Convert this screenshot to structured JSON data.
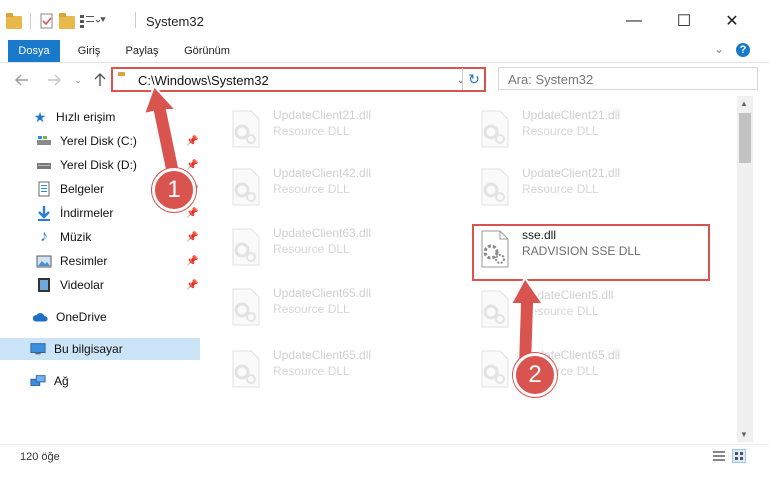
{
  "window": {
    "title": "System32",
    "minimize_glyph": "—",
    "maximize_glyph": "☐",
    "close_glyph": "✕"
  },
  "ribbon": {
    "tabs": [
      "Dosya",
      "Giriş",
      "Paylaş",
      "Görünüm"
    ],
    "help_glyph": "?",
    "expand_glyph": "⌄"
  },
  "address": {
    "path": "C:\\Windows\\System32",
    "refresh_glyph": "↻"
  },
  "search": {
    "placeholder": "Ara: System32"
  },
  "nav": {
    "items": [
      {
        "label": "Hızlı erişim",
        "icon": "star-icon",
        "pinned": false
      },
      {
        "label": "Yerel Disk (C:)",
        "icon": "drive-icon",
        "pinned": true
      },
      {
        "label": "Yerel Disk (D:)",
        "icon": "drive-icon",
        "pinned": true
      },
      {
        "label": "Belgeler",
        "icon": "documents-icon",
        "pinned": true
      },
      {
        "label": "İndirmeler",
        "icon": "download-icon",
        "pinned": true
      },
      {
        "label": "Müzik",
        "icon": "music-icon",
        "pinned": true
      },
      {
        "label": "Resimler",
        "icon": "pictures-icon",
        "pinned": true
      },
      {
        "label": "Videolar",
        "icon": "videos-icon",
        "pinned": true
      },
      {
        "label": "OneDrive",
        "icon": "cloud-icon",
        "pinned": false
      },
      {
        "label": "Bu bilgisayar",
        "icon": "computer-icon",
        "pinned": false
      },
      {
        "label": "Ağ",
        "icon": "network-icon",
        "pinned": false
      }
    ]
  },
  "files": {
    "left": [
      {
        "name": "UpdateClient21.dll",
        "desc": "Resource DLL"
      },
      {
        "name": "UpdateClient42.dll",
        "desc": "Resource DLL"
      },
      {
        "name": "UpdateClient63.dll",
        "desc": "Resource DLL"
      },
      {
        "name": "UpdateClient65.dll",
        "desc": "Resource DLL"
      },
      {
        "name": "UpdateClient65.dll",
        "desc": "Resource DLL"
      }
    ],
    "right": [
      {
        "name": "UpdateClient21.dll",
        "desc": "Resource DLL"
      },
      {
        "name": "UpdateClient21.dll",
        "desc": "Resource DLL"
      },
      {
        "name": "sse.dll",
        "desc": "RADVISION SSE DLL"
      },
      {
        "name": "UpdateClient5.dll",
        "desc": "Resource DLL"
      },
      {
        "name": "UpdateClient65.dll",
        "desc": "Resource DLL"
      }
    ]
  },
  "status": {
    "count": "120 öğe"
  },
  "annotations": {
    "step1": "1",
    "step2": "2",
    "color": "#d9534f"
  }
}
